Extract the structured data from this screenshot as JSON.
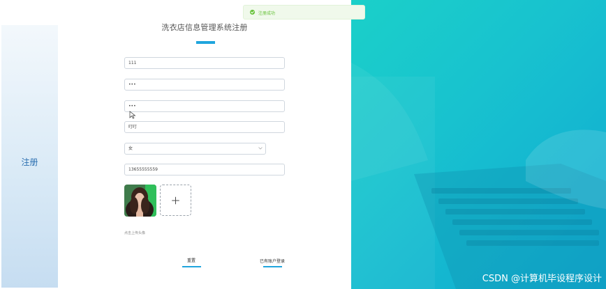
{
  "sidebar": {
    "label": "注册"
  },
  "form": {
    "title": "洗衣店信息管理系统注册",
    "fields": {
      "username": "111",
      "password": "•••",
      "confirm_password": "•••",
      "name": "叮叮",
      "gender": "女",
      "phone": "13655555559"
    },
    "avatar_hint": "点击上传头像",
    "reset_label": "重置",
    "login_label": "已有账户登录"
  },
  "toast": {
    "message": "注册成功",
    "color": "#67c23a"
  },
  "watermark": "CSDN @计算机毕设程序设计",
  "colors": {
    "accent": "#1fa5dd",
    "right_bg": "#18c2cf"
  }
}
